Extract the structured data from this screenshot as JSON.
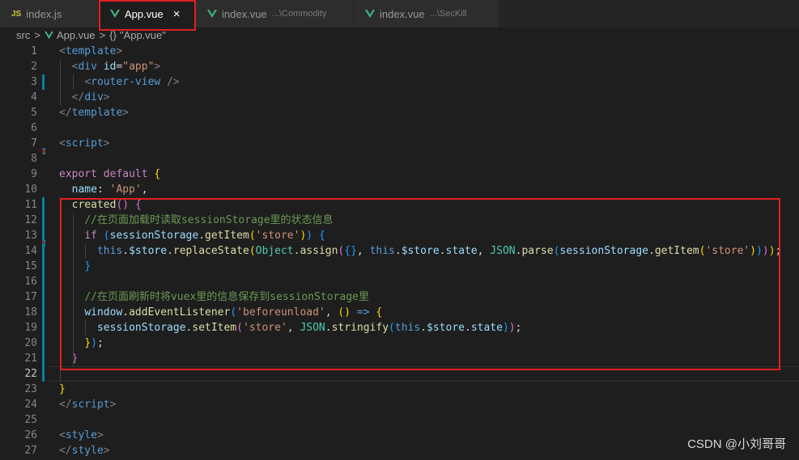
{
  "tabs": [
    {
      "icon": "js-icon",
      "icon_text": "JS",
      "label": "index.js",
      "desc": "",
      "active": false
    },
    {
      "icon": "vue-icon",
      "icon_text": "",
      "label": "App.vue",
      "desc": "",
      "active": true
    },
    {
      "icon": "vue-icon",
      "icon_text": "",
      "label": "index.vue",
      "desc": "...\\Commodity",
      "active": false
    },
    {
      "icon": "vue-icon",
      "icon_text": "",
      "label": "index.vue",
      "desc": "...\\SecKill",
      "active": false
    }
  ],
  "close_glyph": "×",
  "breadcrumb": {
    "folder": "src",
    "sep": ">",
    "file": "App.vue",
    "symbol_icon": "{}",
    "symbol": "\"App.vue\""
  },
  "colors": {
    "vue": "#41b883",
    "highlight_border": "#e02020",
    "background": "#1e1e1e"
  },
  "current_line": 22,
  "lines": [
    {
      "n": "1",
      "indent": "",
      "tokens": [
        [
          "tp",
          "<"
        ],
        [
          "tg",
          "template"
        ],
        [
          "tp",
          ">"
        ]
      ]
    },
    {
      "n": "2",
      "indent": "  ",
      "tokens": [
        [
          "tp",
          "<"
        ],
        [
          "tg",
          "div"
        ],
        [
          "tk",
          " "
        ],
        [
          "ta",
          "id"
        ],
        [
          "tk",
          "="
        ],
        [
          "ts",
          "\"app\""
        ],
        [
          "tp",
          ">"
        ]
      ]
    },
    {
      "n": "3",
      "indent": "    ",
      "tokens": [
        [
          "tp",
          "<"
        ],
        [
          "tg",
          "router-view"
        ],
        [
          "tk",
          " "
        ],
        [
          "tp",
          "/>"
        ]
      ]
    },
    {
      "n": "4",
      "indent": "  ",
      "tokens": [
        [
          "tp",
          "</"
        ],
        [
          "tg",
          "div"
        ],
        [
          "tp",
          ">"
        ]
      ]
    },
    {
      "n": "5",
      "indent": "",
      "tokens": [
        [
          "tp",
          "</"
        ],
        [
          "tg",
          "template"
        ],
        [
          "tp",
          ">"
        ]
      ]
    },
    {
      "n": "6",
      "indent": "",
      "tokens": []
    },
    {
      "n": "7",
      "indent": "",
      "tokens": [
        [
          "tp",
          "<"
        ],
        [
          "tg",
          "script"
        ],
        [
          "tp",
          ">"
        ]
      ]
    },
    {
      "n": "8",
      "indent": "",
      "tokens": []
    },
    {
      "n": "9",
      "indent": "",
      "tokens": [
        [
          "tkw",
          "export"
        ],
        [
          "tk",
          " "
        ],
        [
          "tkw",
          "default"
        ],
        [
          "tk",
          " "
        ],
        [
          "tb",
          "{"
        ]
      ]
    },
    {
      "n": "10",
      "indent": "  ",
      "tokens": [
        [
          "tv",
          "name"
        ],
        [
          "tk",
          ": "
        ],
        [
          "ts",
          "'App'"
        ],
        [
          "tk",
          ","
        ]
      ]
    },
    {
      "n": "11",
      "indent": "  ",
      "tokens": [
        [
          "tf",
          "created"
        ],
        [
          "tb2",
          "()"
        ],
        [
          "tk",
          " "
        ],
        [
          "tb2",
          "{"
        ]
      ]
    },
    {
      "n": "12",
      "indent": "    ",
      "tokens": [
        [
          "tc",
          "//在页面加载时读取sessionStorage里的状态信息"
        ]
      ]
    },
    {
      "n": "13",
      "indent": "    ",
      "tokens": [
        [
          "tkw",
          "if"
        ],
        [
          "tk",
          " "
        ],
        [
          "tb3",
          "("
        ],
        [
          "tv",
          "sessionStorage"
        ],
        [
          "tk",
          "."
        ],
        [
          "tf",
          "getItem"
        ],
        [
          "tb",
          "("
        ],
        [
          "ts",
          "'store'"
        ],
        [
          "tb",
          ")"
        ],
        [
          "tb3",
          ")"
        ],
        [
          "tk",
          " "
        ],
        [
          "tb3",
          "{"
        ]
      ]
    },
    {
      "n": "14",
      "indent": "      ",
      "tokens": [
        [
          "tth",
          "this"
        ],
        [
          "tk",
          "."
        ],
        [
          "tv",
          "$store"
        ],
        [
          "tk",
          "."
        ],
        [
          "tf",
          "replaceState"
        ],
        [
          "tb",
          "("
        ],
        [
          "tt",
          "Object"
        ],
        [
          "tk",
          "."
        ],
        [
          "tf",
          "assign"
        ],
        [
          "tb2",
          "("
        ],
        [
          "tb3",
          "{}"
        ],
        [
          "tk",
          ", "
        ],
        [
          "tth",
          "this"
        ],
        [
          "tk",
          "."
        ],
        [
          "tv",
          "$store"
        ],
        [
          "tk",
          "."
        ],
        [
          "tv",
          "state"
        ],
        [
          "tk",
          ", "
        ],
        [
          "tt",
          "JSON"
        ],
        [
          "tk",
          "."
        ],
        [
          "tf",
          "parse"
        ],
        [
          "tb3",
          "("
        ],
        [
          "tv",
          "sessionStorage"
        ],
        [
          "tk",
          "."
        ],
        [
          "tf",
          "getItem"
        ],
        [
          "tb",
          "("
        ],
        [
          "ts",
          "'store'"
        ],
        [
          "tb",
          ")"
        ],
        [
          "tb3",
          ")"
        ],
        [
          "tb2",
          ")"
        ],
        [
          "tb",
          ")"
        ],
        [
          "tk",
          ";"
        ]
      ]
    },
    {
      "n": "15",
      "indent": "    ",
      "tokens": [
        [
          "tb3",
          "}"
        ]
      ]
    },
    {
      "n": "16",
      "indent": "",
      "tokens": []
    },
    {
      "n": "17",
      "indent": "    ",
      "tokens": [
        [
          "tc",
          "//在页面刷新时将vuex里的信息保存到sessionStorage里"
        ]
      ]
    },
    {
      "n": "18",
      "indent": "    ",
      "tokens": [
        [
          "tv",
          "window"
        ],
        [
          "tk",
          "."
        ],
        [
          "tf",
          "addEventListener"
        ],
        [
          "tb3",
          "("
        ],
        [
          "ts",
          "'beforeunload'"
        ],
        [
          "tk",
          ", "
        ],
        [
          "tb",
          "()"
        ],
        [
          "tk",
          " "
        ],
        [
          "tth",
          "=>"
        ],
        [
          "tk",
          " "
        ],
        [
          "tb",
          "{"
        ]
      ]
    },
    {
      "n": "19",
      "indent": "      ",
      "tokens": [
        [
          "tv",
          "sessionStorage"
        ],
        [
          "tk",
          "."
        ],
        [
          "tf",
          "setItem"
        ],
        [
          "tb2",
          "("
        ],
        [
          "ts",
          "'store'"
        ],
        [
          "tk",
          ", "
        ],
        [
          "tt",
          "JSON"
        ],
        [
          "tk",
          "."
        ],
        [
          "tf",
          "stringify"
        ],
        [
          "tb3",
          "("
        ],
        [
          "tth",
          "this"
        ],
        [
          "tk",
          "."
        ],
        [
          "tv",
          "$store"
        ],
        [
          "tk",
          "."
        ],
        [
          "tv",
          "state"
        ],
        [
          "tb3",
          ")"
        ],
        [
          "tb2",
          ")"
        ],
        [
          "tk",
          ";"
        ]
      ]
    },
    {
      "n": "20",
      "indent": "    ",
      "tokens": [
        [
          "tb",
          "}"
        ],
        [
          "tb3",
          ")"
        ],
        [
          "tk",
          ";"
        ]
      ]
    },
    {
      "n": "21",
      "indent": "  ",
      "tokens": [
        [
          "tb2",
          "}"
        ]
      ]
    },
    {
      "n": "22",
      "indent": "",
      "tokens": []
    },
    {
      "n": "23",
      "indent": "",
      "tokens": [
        [
          "tb",
          "}"
        ]
      ]
    },
    {
      "n": "24",
      "indent": "",
      "tokens": [
        [
          "tp",
          "</"
        ],
        [
          "tg",
          "script"
        ],
        [
          "tp",
          ">"
        ]
      ]
    },
    {
      "n": "25",
      "indent": "",
      "tokens": []
    },
    {
      "n": "26",
      "indent": "",
      "tokens": [
        [
          "tp",
          "<"
        ],
        [
          "tg",
          "style"
        ],
        [
          "tp",
          ">"
        ]
      ]
    },
    {
      "n": "27",
      "indent": "",
      "tokens": [
        [
          "tp",
          "</"
        ],
        [
          "tg",
          "style"
        ],
        [
          "tp",
          ">"
        ]
      ]
    }
  ],
  "watermark": "CSDN @小刘哥哥"
}
